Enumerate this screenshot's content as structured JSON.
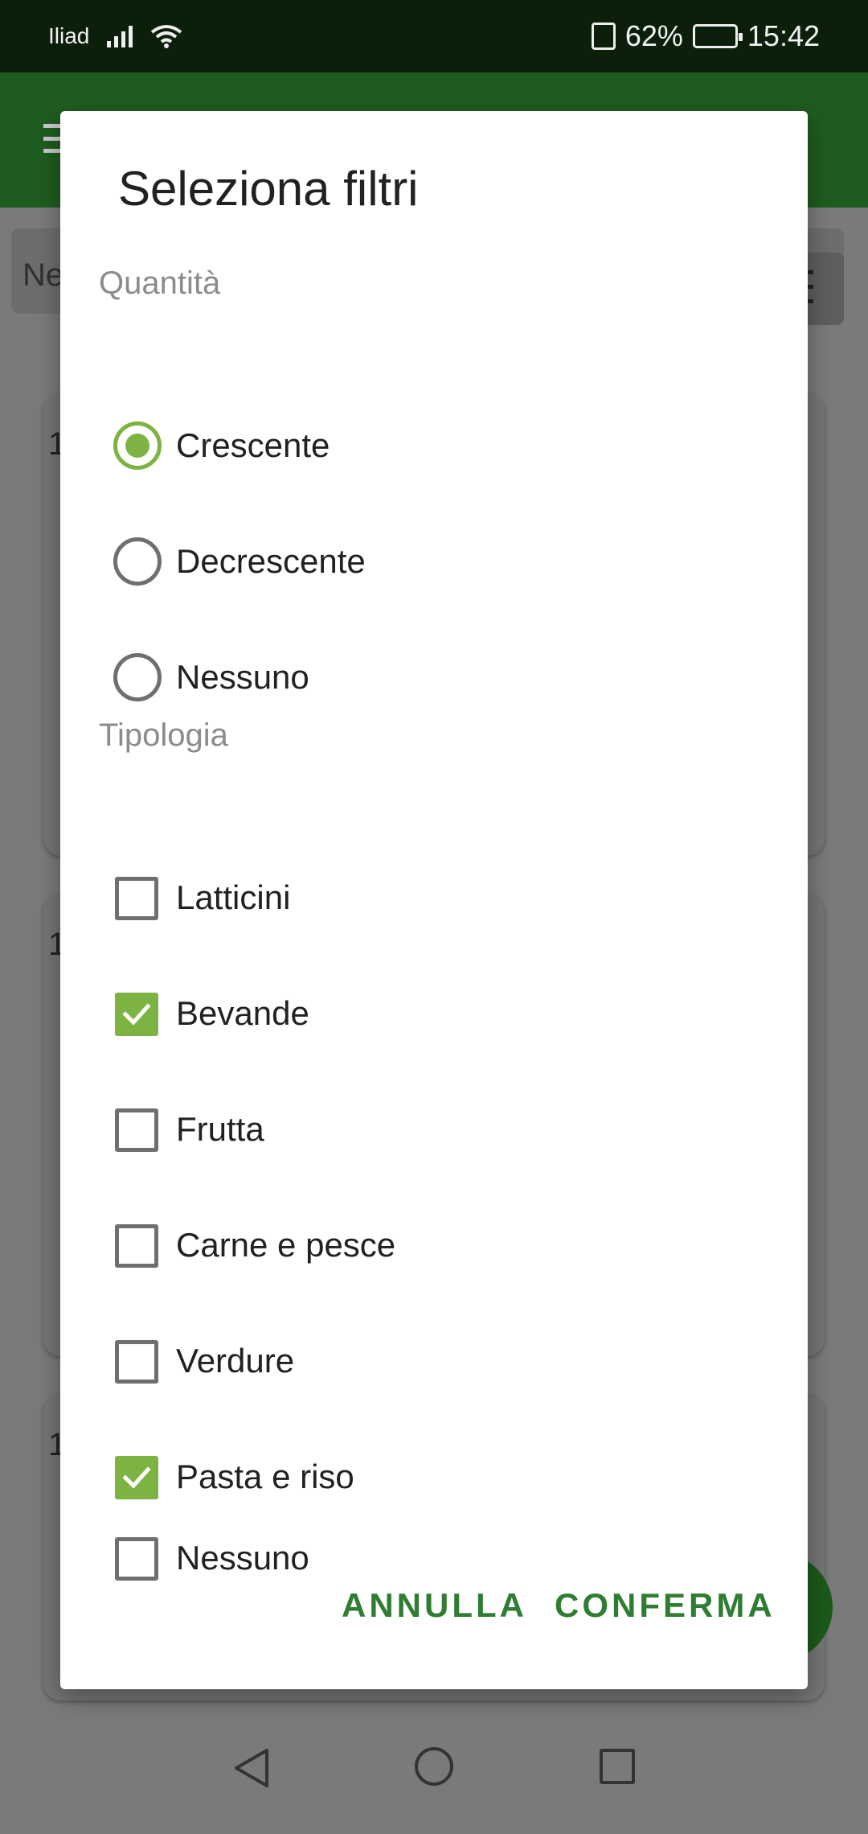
{
  "status_bar": {
    "carrier": "Iliad",
    "battery_percent": "62%",
    "battery_level": 0.62,
    "time": "15:42"
  },
  "background": {
    "search_text": "Ne",
    "card_numbers": [
      "1",
      "1",
      "1"
    ]
  },
  "dialog": {
    "title": "Seleziona filtri",
    "sections": {
      "quantity": {
        "label": "Quantità",
        "options": [
          {
            "label": "Crescente",
            "checked": true
          },
          {
            "label": "Decrescente",
            "checked": false
          },
          {
            "label": "Nessuno",
            "checked": false
          }
        ]
      },
      "type": {
        "label": "Tipologia",
        "options": [
          {
            "label": "Latticini",
            "checked": false
          },
          {
            "label": "Bevande",
            "checked": true
          },
          {
            "label": "Frutta",
            "checked": false
          },
          {
            "label": "Carne e pesce",
            "checked": false
          },
          {
            "label": "Verdure",
            "checked": false
          },
          {
            "label": "Pasta e riso",
            "checked": true
          },
          {
            "label": "Nessuno",
            "checked": false
          }
        ]
      }
    },
    "buttons": {
      "cancel": "ANNULLA",
      "confirm": "CONFERMA"
    }
  },
  "colors": {
    "accent_green": "#7cb342",
    "button_text": "#2e7d32",
    "app_bar": "#1f5c1f",
    "status_bar": "#0b1f0b"
  },
  "icons": {
    "status": [
      "signal-icon",
      "wifi-icon",
      "vibrate-icon",
      "battery-icon"
    ],
    "nav": [
      "back-icon",
      "home-icon",
      "recents-icon"
    ]
  }
}
